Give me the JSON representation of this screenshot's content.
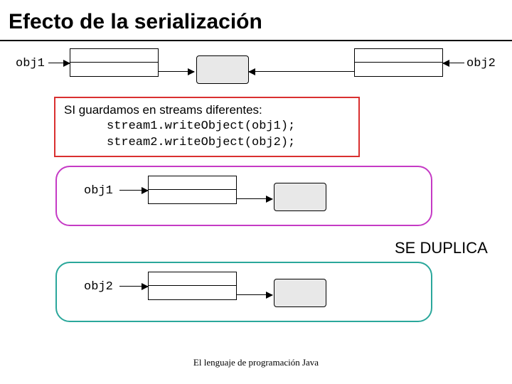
{
  "title": "Efecto de la serialización",
  "top": {
    "obj1_label": "obj1",
    "obj2_label": "obj2"
  },
  "code": {
    "intro": "SI guardamos en streams diferentes:",
    "line1": "stream1.writeObject(obj1);",
    "line2": "stream2.writeObject(obj2);"
  },
  "stream1": {
    "obj_label": "obj1"
  },
  "stream2": {
    "obj_label": "obj2"
  },
  "duplicate_label": "SE DUPLICA",
  "footer": "El lenguaje de programación Java"
}
